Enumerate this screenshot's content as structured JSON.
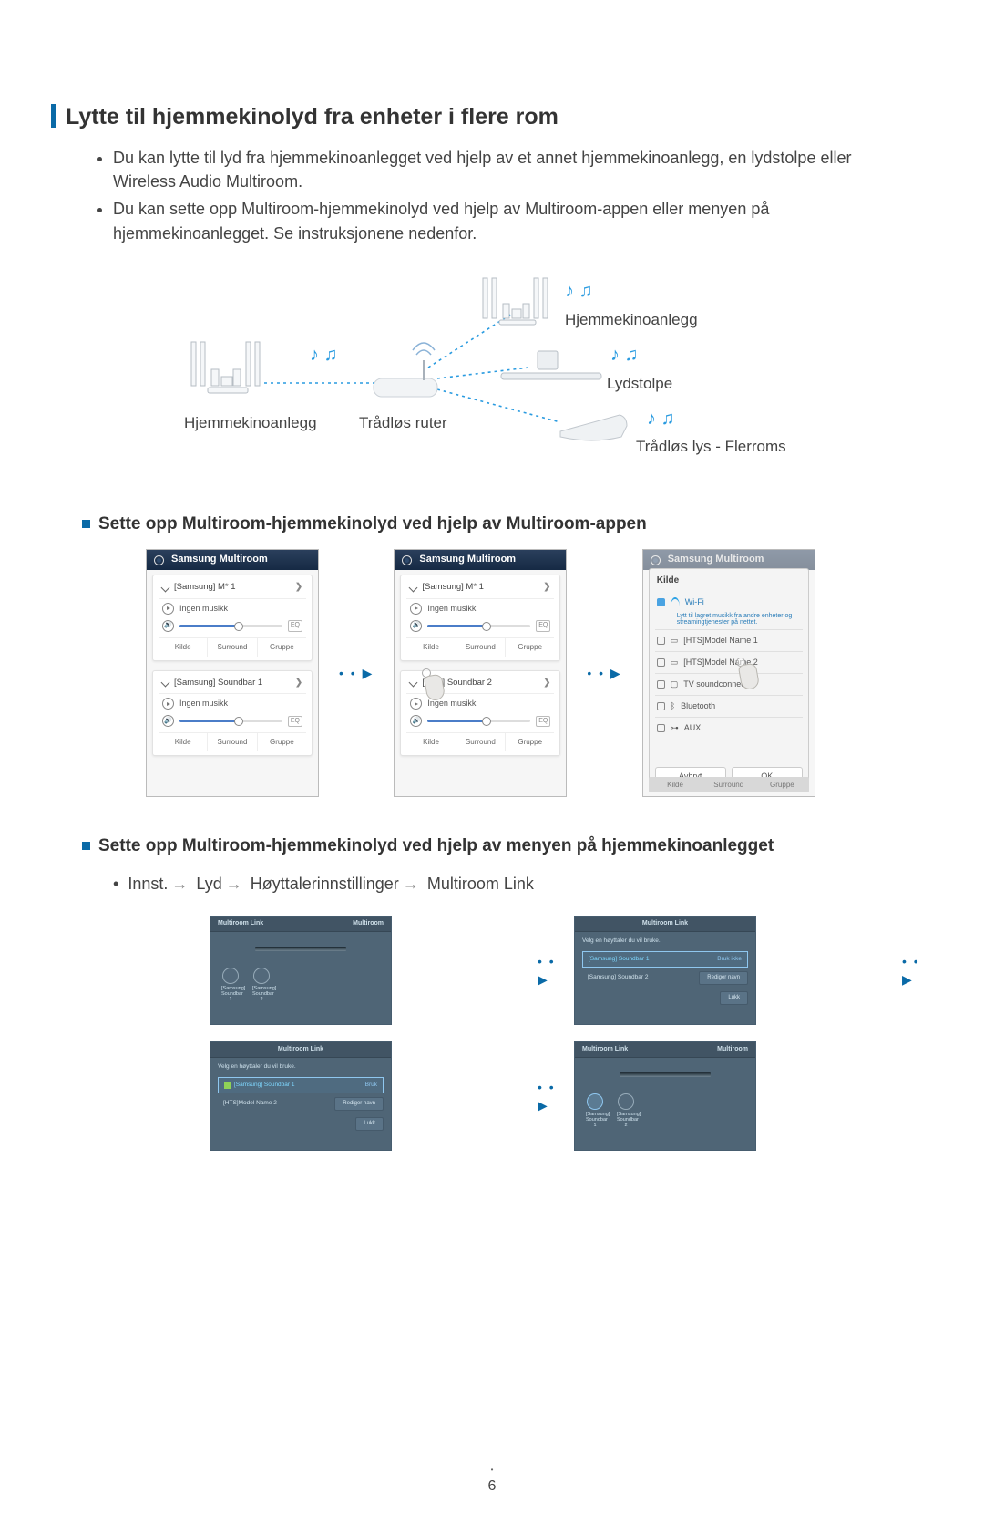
{
  "heading": "Lytte til hjemmekinolyd fra enheter i flere rom",
  "bullets": [
    "Du kan lytte til lyd fra hjemmekinoanlegget ved hjelp av et annet hjemmekinoanlegg, en lydstolpe eller Wireless Audio Multiroom.",
    "Du kan sette opp Multiroom-hjemmekinolyd ved hjelp av Multiroom-appen eller menyen på hjemmekinoanlegget. Se instruksjonene nedenfor."
  ],
  "diagram": {
    "hjemmekino_left": "Hjemmekinoanlegg",
    "router": "Trådløs ruter",
    "hjemmekino_right": "Hjemmekinoanlegg",
    "lydstolpe": "Lydstolpe",
    "multiroom": "Trådløs lys - Flerroms"
  },
  "section_app": "Sette opp Multiroom-hjemmekinolyd ved hjelp av Multiroom-appen",
  "phone": {
    "app_title": "Samsung Multiroom",
    "device1_a": "[Samsung] M* 1",
    "device2_a": "[Samsung] Soundbar 1",
    "device1_b": "[Samsung] M* 1",
    "device2_b": "[Sa      g] Soundbar 2",
    "no_music": "Ingen musikk",
    "tabs": {
      "kilde": "Kilde",
      "surround": "Surround",
      "gruppe": "Gruppe"
    },
    "eq": "EQ"
  },
  "popup": {
    "title": "Kilde",
    "wifi": "Wi-Fi",
    "wifi_sub": "Lytt til lagret musikk fra andre enheter og streamingtjenester på nettet.",
    "s1": "[HTS]Model Name 1",
    "s2": "[HTS]Model Name 2",
    "s3": "TV soundconnect",
    "s4": "Bluetooth",
    "s5": "AUX",
    "cancel": "Avbryt",
    "ok": "OK"
  },
  "section_menu": "Sette opp Multiroom-hjemmekinolyd ved hjelp av menyen på hjemmekinoanlegget",
  "pathline": {
    "bullet": "•",
    "p1": "Innst.",
    "p2": "Lyd",
    "p3": "Høyttalerinnstillinger",
    "p4": "Multiroom Link"
  },
  "tv": {
    "ml": "Multiroom Link",
    "mr": "Multiroom",
    "sub": "Velg en høyttaler du vil bruke.",
    "sb1": "[Samsung] Soundbar 1",
    "sb2": "[Samsung] Soundbar 2",
    "mn2": "[HTS]Model Name 2",
    "use": "Bruk",
    "nouse": "Bruk ikke",
    "rename": "Rediger navn",
    "close": "Lukk",
    "icon1": "[Samsung] Soundbar 1",
    "icon2": "[Samsung] Soundbar 2"
  },
  "pagenum": "6"
}
